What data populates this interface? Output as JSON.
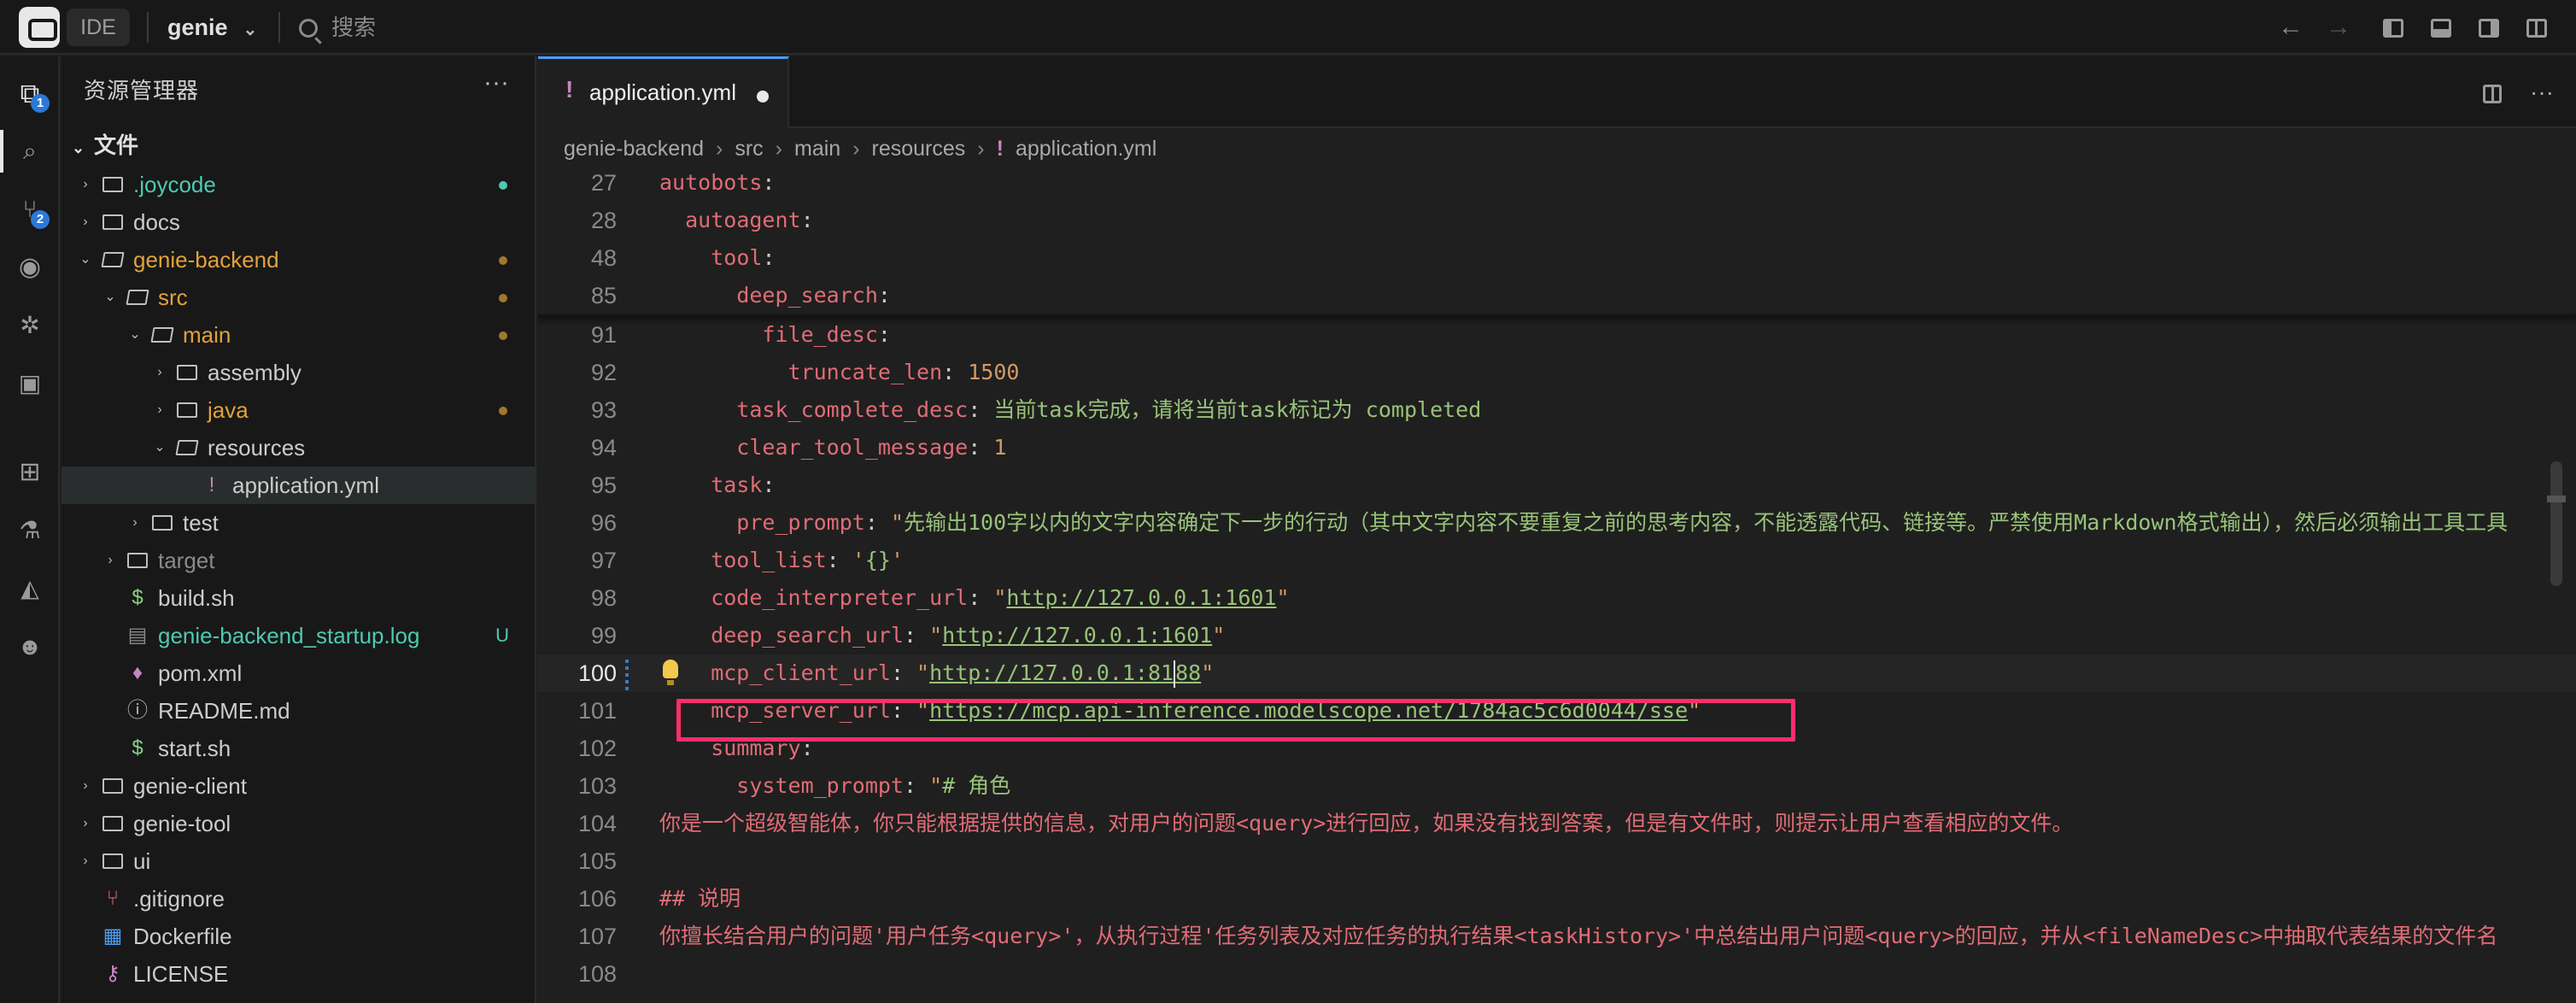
{
  "titlebar": {
    "ide_label": "IDE",
    "project": "genie",
    "search_placeholder": "搜索"
  },
  "activity_bar": {
    "explorer_badge": "1",
    "scm_badge": "2"
  },
  "explorer": {
    "title": "资源管理器",
    "more": "···",
    "section": "文件",
    "items": [
      {
        "name": ".joycode",
        "color": "#4ec9b0",
        "mark": "dot"
      },
      {
        "name": "docs"
      },
      {
        "name": "genie-backend",
        "color": "#e2a23b",
        "mark": "dot"
      },
      {
        "name": "src",
        "color": "#e2a23b",
        "mark": "dot"
      },
      {
        "name": "main",
        "color": "#e2a23b",
        "mark": "dot"
      },
      {
        "name": "assembly"
      },
      {
        "name": "java",
        "color": "#e2a23b",
        "mark": "dot"
      },
      {
        "name": "resources"
      },
      {
        "name": "application.yml"
      },
      {
        "name": "test"
      },
      {
        "name": "target",
        "color": "#8a8a8a"
      },
      {
        "name": "build.sh"
      },
      {
        "name": "genie-backend_startup.log",
        "color": "#4ec9b0",
        "mark": "U"
      },
      {
        "name": "pom.xml"
      },
      {
        "name": "README.md"
      },
      {
        "name": "start.sh"
      },
      {
        "name": "genie-client"
      },
      {
        "name": "genie-tool"
      },
      {
        "name": "ui"
      },
      {
        "name": ".gitignore"
      },
      {
        "name": "Dockerfile"
      },
      {
        "name": "LICENSE"
      }
    ]
  },
  "editor": {
    "tab_label": "application.yml",
    "breadcrumb": [
      "genie-backend",
      "src",
      "main",
      "resources",
      "application.yml"
    ],
    "lines": [
      {
        "n": "27",
        "t": "autobots:"
      },
      {
        "n": "28",
        "t": "  autoagent:"
      },
      {
        "n": "48",
        "t": "    tool:"
      },
      {
        "n": "85",
        "t": "      deep_search:"
      },
      {
        "n": "91",
        "t": "        file_desc:"
      },
      {
        "n": "92",
        "k": "          truncate_len",
        "v": "1500"
      },
      {
        "n": "93",
        "k": "      task_complete_desc",
        "v": "当前task完成，请将当前task标记为 completed"
      },
      {
        "n": "94",
        "k": "      clear_tool_message",
        "v": "1"
      },
      {
        "n": "95",
        "t": "    task:"
      },
      {
        "n": "96",
        "k": "      pre_prompt",
        "v": "\"先输出100字以内的文字内容确定下一步的行动（其中文字内容不要重复之前的思考内容，不能透露代码、链接等。严禁使用Markdown格式输出），然后必须输出工具工具"
      },
      {
        "n": "97",
        "k": "    tool_list",
        "v": "'{}'"
      },
      {
        "n": "98",
        "k": "    code_interpreter_url",
        "v": "http://127.0.0.1:1601"
      },
      {
        "n": "99",
        "k": "    deep_search_url",
        "v": "http://127.0.0.1:1601"
      },
      {
        "n": "100",
        "k": "    mcp_client_url",
        "v": "http://127.0.0.1:8188"
      },
      {
        "n": "101",
        "k": "    mcp_server_url",
        "v": "https://mcp.api-inference.modelscope.net/1784ac5c6d0044/sse"
      },
      {
        "n": "102",
        "t": "    summary:"
      },
      {
        "n": "103",
        "k": "      system_prompt",
        "v": "\"# 角色"
      },
      {
        "n": "104",
        "t": "你是一个超级智能体，你只能根据提供的信息，对用户的问题<query>进行回应，如果没有找到答案，但是有文件时，则提示让用户查看相应的文件。"
      },
      {
        "n": "105",
        "t": ""
      },
      {
        "n": "106",
        "t": "## 说明"
      },
      {
        "n": "107",
        "t": "你擅长结合用户的问题'用户任务<query>'，从执行过程'任务列表及对应任务的执行结果<taskHistory>'中总结出用户问题<query>的回应，并从<fileNameDesc>中抽取代表结果的文件名"
      },
      {
        "n": "108",
        "t": ""
      }
    ]
  }
}
